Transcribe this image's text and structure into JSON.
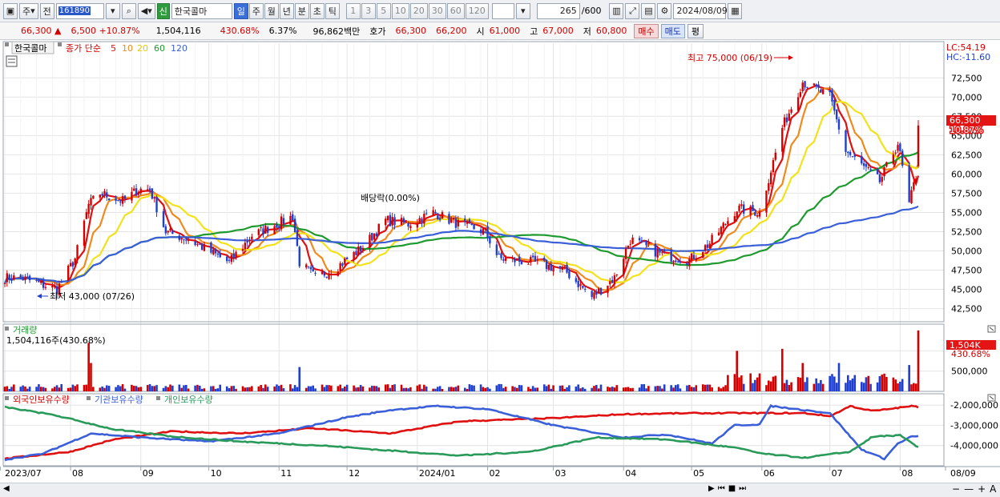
{
  "toolbar": {
    "period_select": "주",
    "prev_label": "전",
    "code": "161890",
    "new_badge": "신",
    "stock_name": "한국콜마",
    "period_tabs": [
      "일",
      "주",
      "월",
      "년",
      "분",
      "초",
      "틱"
    ],
    "active_period": "일",
    "interval_buttons": [
      "1",
      "3",
      "5",
      "10",
      "20",
      "30",
      "60",
      "120"
    ],
    "count": "265",
    "count_max": "/600",
    "date": "2024/08/09"
  },
  "quote": {
    "price": "66,300",
    "up_arrow": "▲",
    "change": "6,500",
    "change_pct": "+10.87%",
    "volume": "1,504,116",
    "volume_ratio": "430.68%",
    "turnover": "6.37%",
    "amount": "96,862백만",
    "ask_label": "호가",
    "ask1": "66,300",
    "ask2": "66,200",
    "open_label": "시",
    "open": "61,000",
    "high_label": "고",
    "high": "67,000",
    "low_label": "저",
    "low": "60,800",
    "buy_label": "매수",
    "sell_label": "매도",
    "eval_label": "평"
  },
  "price_panel": {
    "stock_tag": "한국콜마",
    "legend_title": "종가 단순",
    "ma_labels": [
      "5",
      "10",
      "20",
      "60",
      "120"
    ],
    "lc_label": "LC:54.19",
    "hc_label": "HC:-11.60",
    "high_annotation": "최고 75,000 (06/19)",
    "low_annotation": "최저 43,000 (07/26)",
    "dividend_annotation": "배당락(0.00%)",
    "last_price_tag": "66,300",
    "last_pct_tag": "10.87%"
  },
  "volume_panel": {
    "title": "거래량",
    "value_label": "1,504,116주(430.68%)",
    "last_tag": "1,504K",
    "last_pct_tag": "430.68%"
  },
  "holdings_panel": {
    "legend": [
      "외국인보유수량",
      "기관보유수량",
      "개인보유수량"
    ]
  },
  "x_axis": {
    "month_labels": [
      "2023/07",
      "08",
      "09",
      "10",
      "11",
      "12",
      "2024/01",
      "02",
      "03",
      "04",
      "05",
      "06",
      "07",
      "08",
      "08/09"
    ]
  },
  "colors": {
    "up": "#d40000",
    "down": "#1e3fd0",
    "ma5": "#e01010",
    "ma10": "#f08a1c",
    "ma20": "#f2e21a",
    "ma60": "#1e9a2e",
    "ma120": "#3a5fd8",
    "foreign": "#e01010",
    "institution": "#3a5fd8",
    "individual": "#2a9a5a"
  },
  "chart_data": [
    {
      "type": "candlestick",
      "title": "",
      "ylim": [
        41000,
        77000
      ],
      "y_ticks": [
        42500,
        45000,
        47500,
        50000,
        52500,
        55000,
        57500,
        60000,
        62500,
        65000,
        67500,
        70000,
        72500
      ],
      "y_tick_labels": [
        "42,500",
        "45,000",
        "47,500",
        "50,000",
        "52,500",
        "55,000",
        "57,500",
        "60,000",
        "62,500",
        "65,000",
        "67,500",
        "70,000",
        "72,500"
      ],
      "grid": true,
      "series": [
        {
          "name": "종가",
          "anchors": [
            [
              "2023-07-10",
              46500
            ],
            [
              "2023-07-26",
              45000
            ],
            [
              "2023-08-03",
              49000
            ],
            [
              "2023-08-09",
              56000
            ],
            [
              "2023-08-14",
              57500
            ],
            [
              "2023-08-24",
              56500
            ],
            [
              "2023-08-31",
              58000
            ],
            [
              "2023-09-05",
              58000
            ],
            [
              "2023-09-12",
              52500
            ],
            [
              "2023-09-22",
              51500
            ],
            [
              "2023-10-10",
              48500
            ],
            [
              "2023-10-20",
              52000
            ],
            [
              "2023-10-31",
              53500
            ],
            [
              "2023-11-07",
              54500
            ],
            [
              "2023-11-10",
              48500
            ],
            [
              "2023-11-17",
              46500
            ],
            [
              "2023-11-27",
              48000
            ],
            [
              "2023-12-08",
              50500
            ],
            [
              "2023-12-18",
              54000
            ],
            [
              "2023-12-28",
              53500
            ],
            [
              "2024-01-08",
              55000
            ],
            [
              "2024-01-19",
              53500
            ],
            [
              "2024-01-31",
              52500
            ],
            [
              "2024-02-06",
              49000
            ],
            [
              "2024-02-21",
              48500
            ],
            [
              "2024-03-06",
              47500
            ],
            [
              "2024-03-18",
              44000
            ],
            [
              "2024-03-28",
              46500
            ],
            [
              "2024-04-04",
              51500
            ],
            [
              "2024-04-18",
              49500
            ],
            [
              "2024-04-30",
              48800
            ],
            [
              "2024-05-09",
              51000
            ],
            [
              "2024-05-21",
              55500
            ],
            [
              "2024-05-31",
              55000
            ],
            [
              "2024-06-10",
              66000
            ],
            [
              "2024-06-19",
              72000
            ],
            [
              "2024-07-01",
              70000
            ],
            [
              "2024-07-08",
              63000
            ],
            [
              "2024-07-23",
              59000
            ],
            [
              "2024-07-31",
              64000
            ],
            [
              "2024-08-05",
              56000
            ],
            [
              "2024-08-08",
              59800
            ],
            [
              "2024-08-09",
              66300
            ]
          ]
        },
        {
          "name": "5",
          "period": 5
        },
        {
          "name": "10",
          "period": 10
        },
        {
          "name": "20",
          "period": 20
        },
        {
          "name": "60",
          "period": 60
        },
        {
          "name": "120",
          "period": 120
        }
      ],
      "high_point": {
        "date": "2024-06-19",
        "value": 75000
      },
      "low_point": {
        "date": "2023-07-26",
        "value": 43000
      },
      "last": {
        "date": "2024-08-09",
        "open": 61000,
        "high": 67000,
        "low": 60800,
        "close": 66300
      }
    },
    {
      "type": "bar",
      "title": "거래량",
      "ylim": [
        0,
        1600000
      ],
      "y_ticks": [
        500000,
        1000000
      ],
      "y_tick_labels": [
        "500,000",
        "1,000K"
      ],
      "last_volume": 1504116,
      "spikes": [
        [
          "2023-08-09",
          1200000
        ],
        [
          "2023-08-10",
          700000
        ],
        [
          "2023-11-10",
          600000
        ],
        [
          "2024-05-21",
          1000000
        ],
        [
          "2024-06-10",
          1050000
        ],
        [
          "2024-06-19",
          700000
        ],
        [
          "2024-07-05",
          700000
        ],
        [
          "2024-08-05",
          650000
        ],
        [
          "2024-08-09",
          1504116
        ]
      ]
    },
    {
      "type": "line",
      "title": "",
      "ylim": [
        -5000000,
        -1600000
      ],
      "y_ticks": [
        -2000000,
        -3000000,
        -4000000
      ],
      "y_tick_labels": [
        "-2,000,000",
        "-3,000,000",
        "-4,000,000"
      ],
      "series": [
        {
          "name": "외국인보유수량",
          "anchors": [
            [
              "2023-07-03",
              -4650000
            ],
            [
              "2023-08-01",
              -4300000
            ],
            [
              "2023-08-20",
              -3700000
            ],
            [
              "2023-09-15",
              -3300000
            ],
            [
              "2023-10-15",
              -3400000
            ],
            [
              "2023-11-15",
              -3150000
            ],
            [
              "2023-12-20",
              -3400000
            ],
            [
              "2024-01-20",
              -2800000
            ],
            [
              "2024-03-01",
              -2650000
            ],
            [
              "2024-04-01",
              -2450000
            ],
            [
              "2024-05-01",
              -2400000
            ],
            [
              "2024-06-01",
              -2400000
            ],
            [
              "2024-06-20",
              -2400000
            ],
            [
              "2024-07-01",
              -2550000
            ],
            [
              "2024-07-10",
              -2050000
            ],
            [
              "2024-07-20",
              -2300000
            ],
            [
              "2024-08-06",
              -2050000
            ],
            [
              "2024-08-09",
              -2100000
            ]
          ]
        },
        {
          "name": "기관보유수량",
          "anchors": [
            [
              "2023-07-03",
              -4700000
            ],
            [
              "2023-07-20",
              -4400000
            ],
            [
              "2023-08-10",
              -3400000
            ],
            [
              "2023-09-01",
              -3600000
            ],
            [
              "2023-10-01",
              -3800000
            ],
            [
              "2023-11-01",
              -3400000
            ],
            [
              "2023-12-01",
              -2600000
            ],
            [
              "2023-12-20",
              -2250000
            ],
            [
              "2024-01-10",
              -2050000
            ],
            [
              "2024-02-01",
              -2200000
            ],
            [
              "2024-03-01",
              -3000000
            ],
            [
              "2024-04-01",
              -3600000
            ],
            [
              "2024-04-20",
              -3450000
            ],
            [
              "2024-05-10",
              -3900000
            ],
            [
              "2024-05-20",
              -3000000
            ],
            [
              "2024-05-31",
              -2950000
            ],
            [
              "2024-06-05",
              -2050000
            ],
            [
              "2024-06-20",
              -2250000
            ],
            [
              "2024-07-01",
              -2400000
            ],
            [
              "2024-07-15",
              -4200000
            ],
            [
              "2024-07-25",
              -4650000
            ],
            [
              "2024-07-31",
              -3900000
            ],
            [
              "2024-08-06",
              -3550000
            ],
            [
              "2024-08-09",
              -3550000
            ]
          ]
        },
        {
          "name": "개인보유수량",
          "anchors": [
            [
              "2023-07-03",
              -2100000
            ],
            [
              "2023-07-25",
              -2500000
            ],
            [
              "2023-08-20",
              -3200000
            ],
            [
              "2023-09-15",
              -3550000
            ],
            [
              "2023-10-15",
              -3800000
            ],
            [
              "2023-11-20",
              -4000000
            ],
            [
              "2023-12-20",
              -4250000
            ],
            [
              "2024-01-20",
              -4500000
            ],
            [
              "2024-02-20",
              -4300000
            ],
            [
              "2024-03-20",
              -3600000
            ],
            [
              "2024-04-20",
              -3700000
            ],
            [
              "2024-05-20",
              -4100000
            ],
            [
              "2024-06-01",
              -4400000
            ],
            [
              "2024-06-20",
              -4600000
            ],
            [
              "2024-07-10",
              -4300000
            ],
            [
              "2024-07-20",
              -3550000
            ],
            [
              "2024-08-01",
              -3500000
            ],
            [
              "2024-08-09",
              -4100000
            ]
          ]
        }
      ]
    }
  ]
}
